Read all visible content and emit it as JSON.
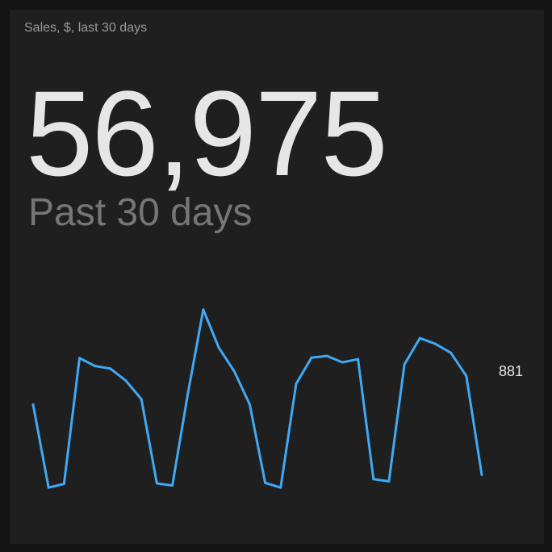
{
  "widget": {
    "title": "Sales, $, last 30 days",
    "value": "56,975",
    "subtitle": "Past 30 days",
    "last_value_label": "881",
    "accent_color": "#3fa9f5"
  },
  "chart_data": {
    "type": "line",
    "x": [
      1,
      2,
      3,
      4,
      5,
      6,
      7,
      8,
      9,
      10,
      11,
      12,
      13,
      14,
      15,
      16,
      17,
      18,
      19,
      20,
      21,
      22,
      23,
      24,
      25,
      26,
      27,
      28,
      29,
      30
    ],
    "values": [
      1680,
      890,
      925,
      2120,
      2045,
      2020,
      1905,
      1730,
      930,
      910,
      1780,
      2580,
      2220,
      1995,
      1680,
      935,
      890,
      1875,
      2125,
      2140,
      2080,
      2110,
      970,
      950,
      2060,
      2310,
      2255,
      2170,
      1950,
      1010
    ],
    "ylim": [
      600,
      2900
    ],
    "grid": false
  }
}
